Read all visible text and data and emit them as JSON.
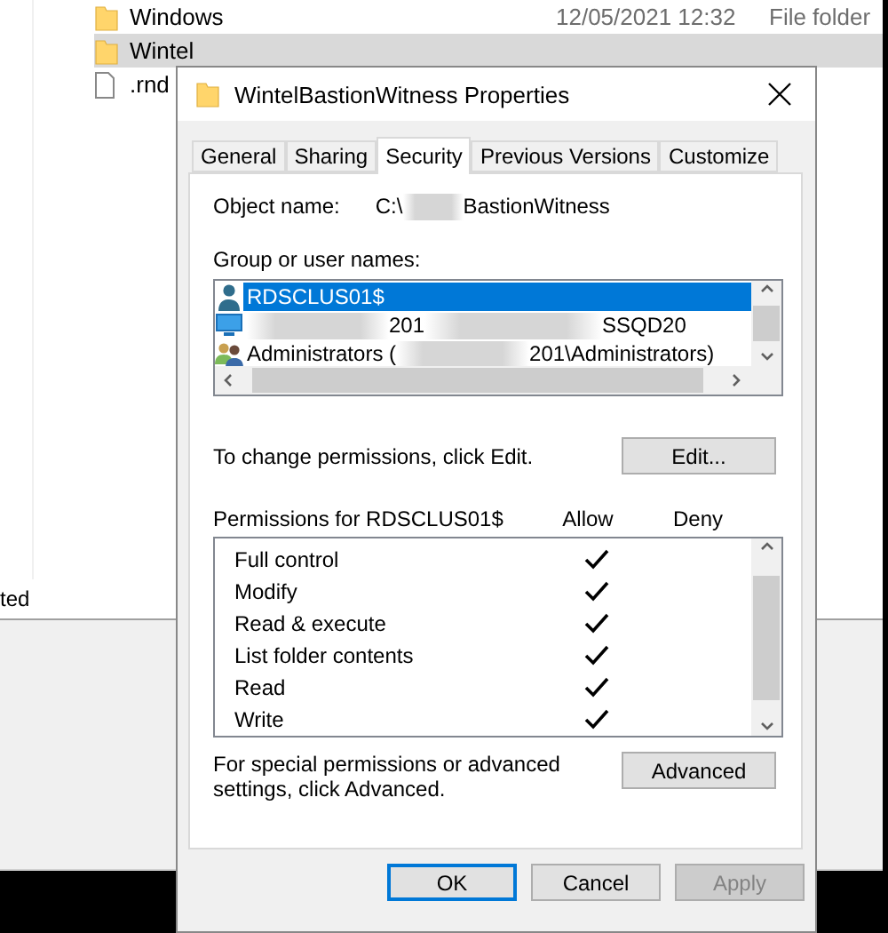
{
  "explorer": {
    "files": [
      {
        "kind": "folder",
        "name": "Windows",
        "date": "12/05/2021 12:32",
        "type": "File folder",
        "selected": false
      },
      {
        "kind": "folder",
        "name": "Wintel",
        "selected": true
      },
      {
        "kind": "file",
        "name": ".rnd",
        "selected": false
      }
    ],
    "status": "ted"
  },
  "dialog": {
    "title": "WintelBastionWitness Properties",
    "tabs": [
      {
        "label": "General",
        "selected": false
      },
      {
        "label": "Sharing",
        "selected": false
      },
      {
        "label": "Security",
        "selected": true
      },
      {
        "label": "Previous Versions",
        "selected": false
      },
      {
        "label": "Customize",
        "selected": false
      }
    ],
    "object_name": {
      "label": "Object name:",
      "parts": [
        "C:\\",
        "BastionWitness"
      ]
    },
    "groups_label": "Group or user names:",
    "groups": [
      {
        "kind": "user",
        "segments": [
          {
            "kind": "text",
            "text": "RDSCLUS01$"
          }
        ],
        "selected": true
      },
      {
        "kind": "computer",
        "segments": [
          {
            "kind": "blur"
          },
          {
            "kind": "text",
            "text": "201"
          },
          {
            "kind": "blur"
          },
          {
            "kind": "text",
            "text": "SSQD20"
          }
        ],
        "selected": false
      },
      {
        "kind": "group",
        "segments": [
          {
            "kind": "text",
            "text": "Administrators ("
          },
          {
            "kind": "blur"
          },
          {
            "kind": "text",
            "text": "201\\Administrators)"
          }
        ],
        "selected": false
      }
    ],
    "edit_hint": "To change permissions, click Edit.",
    "edit_button": "Edit...",
    "permissions_label": "Permissions for RDSCLUS01$",
    "columns": [
      "Allow",
      "Deny"
    ],
    "permissions": [
      {
        "name": "Full control",
        "allow": true,
        "deny": false
      },
      {
        "name": "Modify",
        "allow": true,
        "deny": false
      },
      {
        "name": "Read & execute",
        "allow": true,
        "deny": false
      },
      {
        "name": "List folder contents",
        "allow": true,
        "deny": false
      },
      {
        "name": "Read",
        "allow": true,
        "deny": false
      },
      {
        "name": "Write",
        "allow": true,
        "deny": false
      }
    ],
    "advanced_hint": "For special permissions or advanced settings, click Advanced.",
    "advanced_button": "Advanced",
    "buttons": [
      {
        "label": "OK",
        "disabled": false,
        "default": true
      },
      {
        "label": "Cancel",
        "disabled": false,
        "default": false
      },
      {
        "label": "Apply",
        "disabled": true,
        "default": false
      }
    ]
  }
}
